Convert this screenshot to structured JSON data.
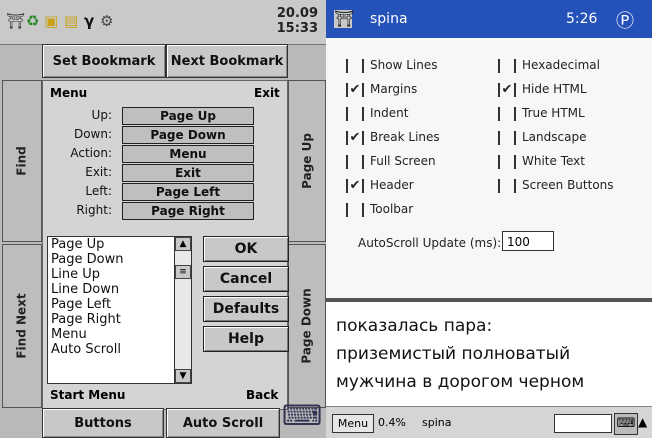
{
  "left": {
    "clock": {
      "date": "20.09",
      "time": "15:33"
    },
    "top_buttons": {
      "set_bookmark": "Set Bookmark",
      "next_bookmark": "Next Bookmark"
    },
    "side_tabs": {
      "find": "Find",
      "find_next": "Find Next",
      "page_up": "Page Up",
      "page_down": "Page Down"
    },
    "panel": {
      "header_left": "Menu",
      "header_right": "Exit",
      "footer_left": "Start Menu",
      "footer_right": "Back"
    },
    "actions": [
      {
        "label": "Up:",
        "value": "Page Up"
      },
      {
        "label": "Down:",
        "value": "Page Down"
      },
      {
        "label": "Action:",
        "value": "Menu"
      },
      {
        "label": "Exit:",
        "value": "Exit"
      },
      {
        "label": "Left:",
        "value": "Page Left"
      },
      {
        "label": "Right:",
        "value": "Page Right"
      }
    ],
    "list_items": [
      "Page Up",
      "Page Down",
      "Line Up",
      "Line Down",
      "Page Left",
      "Page Right",
      "Menu",
      "Auto Scroll"
    ],
    "dialog_buttons": {
      "ok": "OK",
      "cancel": "Cancel",
      "defaults": "Defaults",
      "help": "Help"
    },
    "bottom_tabs": {
      "buttons": "Buttons",
      "auto_scroll": "Auto Scroll"
    }
  },
  "right": {
    "title": "spina",
    "time": "5:26",
    "checkboxes_left": [
      {
        "label": "Show Lines",
        "checked": false
      },
      {
        "label": "Margins",
        "checked": true
      },
      {
        "label": "Indent",
        "checked": false
      },
      {
        "label": "Break Lines",
        "checked": true
      },
      {
        "label": "Full Screen",
        "checked": false
      },
      {
        "label": "Header",
        "checked": true
      },
      {
        "label": "Toolbar",
        "checked": false
      }
    ],
    "checkboxes_right": [
      {
        "label": "Hexadecimal",
        "checked": false
      },
      {
        "label": "Hide HTML",
        "checked": true
      },
      {
        "label": "True HTML",
        "checked": false
      },
      {
        "label": "Landscape",
        "checked": false
      },
      {
        "label": "White Text",
        "checked": false
      },
      {
        "label": "Screen Buttons",
        "checked": false
      }
    ],
    "autoscroll": {
      "label": "AutoScroll Update (ms):",
      "value": "100"
    },
    "reading_lines": [
      "показалась пара:",
      "приземистый полноватый",
      "мужчина в дорогом черном"
    ],
    "status": {
      "menu": "Menu",
      "percent": "0.4%",
      "doc": "spina"
    }
  }
}
